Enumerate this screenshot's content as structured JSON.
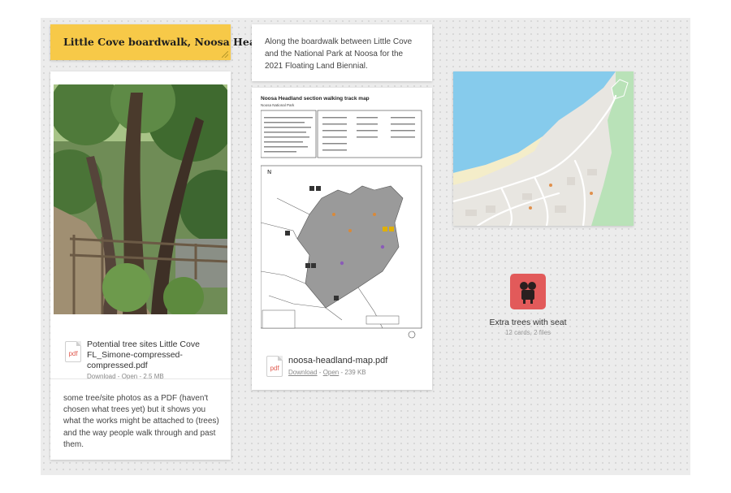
{
  "board": {
    "note_title": "Little Cove boardwalk, Noosa Heads.",
    "note_text": "Along the boardwalk between Little Cove and the National Park at Noosa for the 2021 Floating Land Biennial.",
    "photo_file": {
      "icon_label": "pdf",
      "name": "Potential tree sites Little Cove FL_Simone-compressed-compressed.pdf",
      "download": "Download",
      "open": "Open",
      "size": "2.5 MB",
      "sep": " - "
    },
    "photo_description": "some tree/site photos as a PDF (haven't chosen what trees yet) but it shows you what the works might be attached to (trees) and the way people walk through and past them.",
    "map_file": {
      "doc_title": "Noosa Headland section walking track map",
      "doc_subtitle": "Noosa National Park",
      "icon_label": "pdf",
      "name": "noosa-headland-map.pdf",
      "download": "Download",
      "open": "Open",
      "size": "239 KB",
      "sep": " - "
    },
    "collection": {
      "title": "Extra trees with seat",
      "meta": "12 cards, 2 files",
      "icon": "seat-icon",
      "color": "#e25a5a"
    }
  }
}
